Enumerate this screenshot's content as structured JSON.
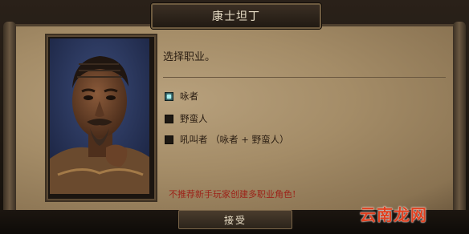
{
  "dialog": {
    "title": "康士坦丁",
    "prompt": "选择职业。",
    "warning": "不推荐新手玩家创建多职业角色!",
    "accept_label": "接受"
  },
  "options": [
    {
      "label": "咏者",
      "checked": true
    },
    {
      "label": "野蛮人",
      "checked": false
    },
    {
      "label": "吼叫者 （咏者 + 野蛮人）",
      "checked": false
    }
  ],
  "watermark": "云南龙网",
  "colors": {
    "parchment": "#a48c67",
    "warning_text": "#9c2218",
    "checked_box": "#264f52",
    "watermark": "#e0401f"
  }
}
